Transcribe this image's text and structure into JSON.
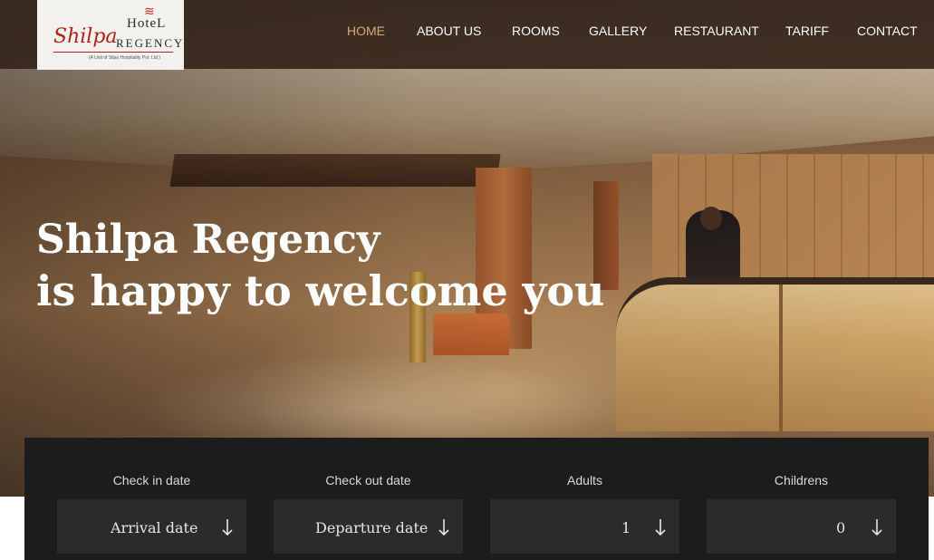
{
  "logo": {
    "hotel": "HoteL",
    "name": "Shilpa",
    "regency": "REGENCY",
    "subtitle": "(A Unit of Silpa Hospitality Pvt. Ltd.)"
  },
  "nav": {
    "items": [
      {
        "label": "HOME",
        "active": true
      },
      {
        "label": "ABOUT US",
        "active": false
      },
      {
        "label": "ROOMS",
        "active": false
      },
      {
        "label": "GALLERY",
        "active": false
      },
      {
        "label": "RESTAURANT",
        "active": false
      },
      {
        "label": "TARIFF",
        "active": false
      },
      {
        "label": "CONTACT",
        "active": false
      }
    ]
  },
  "hero": {
    "line1": "Shilpa Regency",
    "line2": "is happy to welcome you"
  },
  "booking": {
    "fields": [
      {
        "label": "Check in date",
        "value": "Arrival date",
        "icon": "arrow-down-icon"
      },
      {
        "label": "Check out date",
        "value": "Departure date",
        "icon": "arrow-down-icon"
      },
      {
        "label": "Adults",
        "value": "1",
        "icon": "arrow-down-icon"
      },
      {
        "label": "Childrens",
        "value": "0",
        "icon": "arrow-down-icon"
      }
    ]
  },
  "colors": {
    "nav_active": "#d4a97a",
    "booking_bg": "#1c1c1c",
    "field_bg": "#2b2b2b",
    "logo_red": "#b1201b"
  }
}
